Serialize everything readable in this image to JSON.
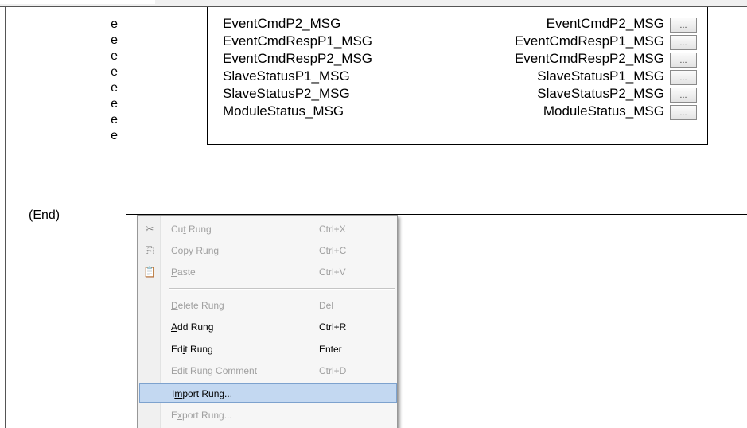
{
  "rung_markers": [
    "e",
    "e",
    "e",
    "e",
    "e",
    "e",
    "e",
    "e"
  ],
  "end_label": "(End)",
  "messages": [
    {
      "name": "EventCmdP2_MSG",
      "value": "EventCmdP2_MSG",
      "browse": "..."
    },
    {
      "name": "EventCmdRespP1_MSG",
      "value": "EventCmdRespP1_MSG",
      "browse": "..."
    },
    {
      "name": "EventCmdRespP2_MSG",
      "value": "EventCmdRespP2_MSG",
      "browse": "..."
    },
    {
      "name": "SlaveStatusP1_MSG",
      "value": "SlaveStatusP1_MSG",
      "browse": "..."
    },
    {
      "name": "SlaveStatusP2_MSG",
      "value": "SlaveStatusP2_MSG",
      "browse": "..."
    },
    {
      "name": "ModuleStatus_MSG",
      "value": "ModuleStatus_MSG",
      "browse": "..."
    }
  ],
  "context_menu": {
    "items": [
      {
        "pre": "Cu",
        "key": "t",
        "post": " Rung",
        "shortcut": "Ctrl+X",
        "icon": "scissors-icon",
        "enabled": false
      },
      {
        "pre": "",
        "key": "C",
        "post": "opy Rung",
        "shortcut": "Ctrl+C",
        "icon": "copy-icon",
        "enabled": false
      },
      {
        "pre": "",
        "key": "P",
        "post": "aste",
        "shortcut": "Ctrl+V",
        "icon": "paste-icon",
        "enabled": false
      },
      {
        "pre": "",
        "key": "D",
        "post": "elete Rung",
        "shortcut": "Del",
        "enabled": false
      },
      {
        "pre": "",
        "key": "A",
        "post": "dd Rung",
        "shortcut": "Ctrl+R",
        "enabled": true
      },
      {
        "pre": "Ed",
        "key": "i",
        "post": "t Rung",
        "shortcut": "Enter",
        "enabled": true
      },
      {
        "pre": "Edit ",
        "key": "R",
        "post": "ung Comment",
        "shortcut": "Ctrl+D",
        "enabled": false
      },
      {
        "pre": "I",
        "key": "m",
        "post": "port Rung...",
        "shortcut": "",
        "enabled": true,
        "highlighted": true
      },
      {
        "pre": "E",
        "key": "x",
        "post": "port Rung...",
        "shortcut": "",
        "enabled": false
      }
    ]
  }
}
